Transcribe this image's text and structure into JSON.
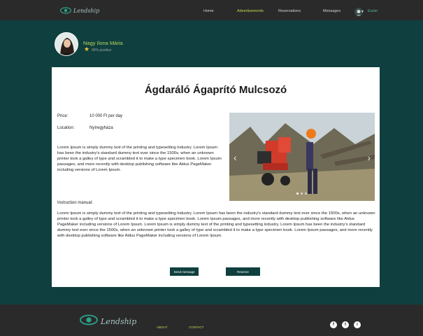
{
  "brand": {
    "name": "Lendship"
  },
  "nav": {
    "home": "Home",
    "advertisements": "Advertisements",
    "reservations": "Reservations",
    "messages": "Messages",
    "user_name": "Eszter"
  },
  "profile": {
    "name": "Nagy Ilona Mária",
    "rating": "96% positive"
  },
  "listing": {
    "title": "Ágdaráló Ágaprító Mulcsozó",
    "price_label": "Price:",
    "price": "10 000 Ft per day",
    "location_label": "Location:",
    "location": "Nyíregyháza",
    "description": "Lorem Ipsum is simply dummy text of the printing and typesetting industry. Lorem Ipsum has been the industry's standard dummy text ever since the 1500s, when an unknown printer took a galley of type and scrambled it to make a type specimen book. Lorem Ipsum passages, and more recently with desktop publishing software like Aldus PageMaker including versions of Lorem Ipsum.",
    "manual_label": "Instruction manual:",
    "manual": "Lorem Ipsum is simply dummy text of the printing and typesetting industry. Lorem Ipsum has been the industry's standard dummy text ever since the 1500s, when an unknown printer took a galley of type and scrambled it to make a type specimen book. Lorem Ipsum passages, and more recently with desktop publishing software like Aldus PageMaker including versions of Lorem Ipsum. Lorem Ipsum is simply dummy text of the printing and typesetting industry. Lorem Ipsum has been the industry's standard dummy text ever since the 1500s, when an unknown printer took a galley of type and scrambled it to make a type specimen book. Lorem Ipsum passages, and more recently with desktop publishing software like Aldus PageMaker including versions of Lorem Ipsum.",
    "send_message": "Send message",
    "reserve": "Reserve"
  },
  "carousel": {
    "prev_icon": "‹",
    "next_icon": "›",
    "slides": 3,
    "active_slide": 1
  },
  "footer": {
    "logo": "Lendship",
    "about": "ABOUT",
    "contact": "CONTACT",
    "social": {
      "facebook": "f",
      "twitter": "t",
      "instagram": "i"
    }
  },
  "colors": {
    "background": "#0f3f3e",
    "bar": "#2a2a2a",
    "accent": "#c3d94e",
    "button": "#0f3f3e"
  }
}
